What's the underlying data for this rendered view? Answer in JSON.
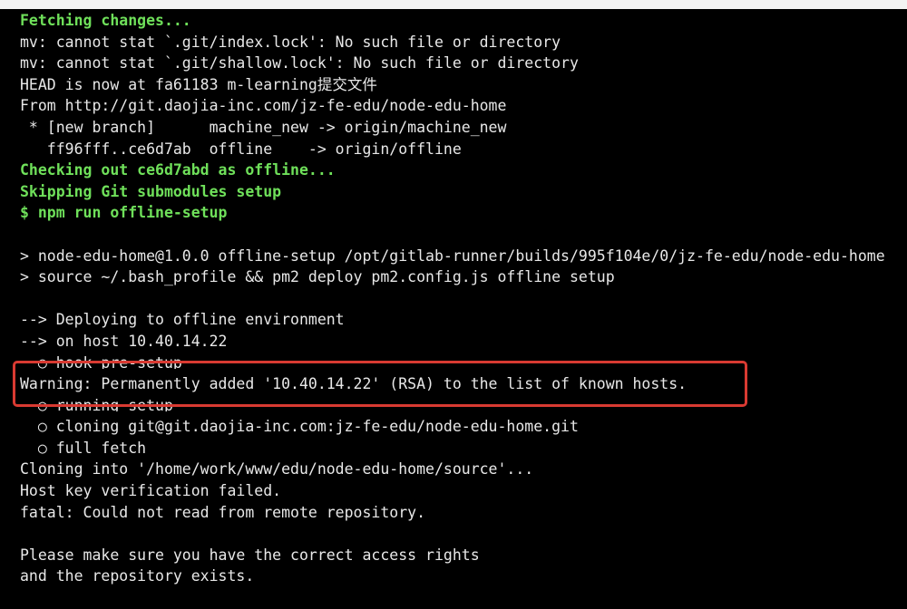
{
  "terminal": {
    "lines": [
      {
        "text": "Fetching changes...",
        "style": "green"
      },
      {
        "text": "mv: cannot stat `.git/index.lock': No such file or directory",
        "style": "plain"
      },
      {
        "text": "mv: cannot stat `.git/shallow.lock': No such file or directory",
        "style": "plain"
      },
      {
        "text": "HEAD is now at fa61183 m-learning提交文件",
        "style": "plain"
      },
      {
        "text": "From http://git.daojia-inc.com/jz-fe-edu/node-edu-home",
        "style": "plain"
      },
      {
        "text": " * [new branch]      machine_new -> origin/machine_new",
        "style": "plain"
      },
      {
        "text": "   ff96fff..ce6d7ab  offline    -> origin/offline",
        "style": "plain"
      },
      {
        "text": "Checking out ce6d7abd as offline...",
        "style": "green"
      },
      {
        "text": "Skipping Git submodules setup",
        "style": "green"
      },
      {
        "text": "$ npm run offline-setup",
        "style": "green"
      },
      {
        "text": "",
        "style": "plain"
      },
      {
        "text": "> node-edu-home@1.0.0 offline-setup /opt/gitlab-runner/builds/995f104e/0/jz-fe-edu/node-edu-home",
        "style": "plain"
      },
      {
        "text": "> source ~/.bash_profile && pm2 deploy pm2.config.js offline setup",
        "style": "plain"
      },
      {
        "text": "",
        "style": "plain"
      },
      {
        "text": "--> Deploying to offline environment",
        "style": "plain"
      },
      {
        "text": "--> on host 10.40.14.22",
        "style": "plain"
      },
      {
        "text": "  ○ hook pre-setup",
        "style": "clipped"
      },
      {
        "text": "Warning: Permanently added '10.40.14.22' (RSA) to the list of known hosts.",
        "style": "plain"
      },
      {
        "text": "  ○ running setup",
        "style": "clipped"
      },
      {
        "text": "  ○ cloning git@git.daojia-inc.com:jz-fe-edu/node-edu-home.git",
        "style": "plain"
      },
      {
        "text": "  ○ full fetch",
        "style": "plain"
      },
      {
        "text": "Cloning into '/home/work/www/edu/node-edu-home/source'...",
        "style": "plain"
      },
      {
        "text": "Host key verification failed.",
        "style": "plain"
      },
      {
        "text": "fatal: Could not read from remote repository.",
        "style": "plain"
      },
      {
        "text": "",
        "style": "plain"
      },
      {
        "text": "Please make sure you have the correct access rights",
        "style": "plain"
      },
      {
        "text": "and the repository exists.",
        "style": "plain"
      }
    ]
  },
  "colors": {
    "background": "#000000",
    "text": "#e8e8e8",
    "success_green": "#6fe05a",
    "highlight_red": "#d93a32"
  }
}
